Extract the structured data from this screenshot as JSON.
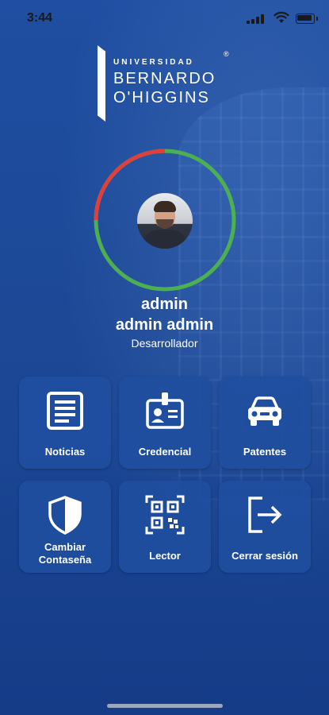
{
  "status_bar": {
    "time": "3:44"
  },
  "logo": {
    "line1": "UNIVERSIDAD",
    "line2": "BERNARDO",
    "line3": "O'HIGGINS",
    "registered": "®"
  },
  "profile": {
    "username": "admin",
    "full_name": "admin admin",
    "role": "Desarrollador",
    "ring_colors": {
      "used": "#e0403a",
      "remaining": "#4caf50"
    }
  },
  "menu": {
    "items": [
      {
        "label": "Noticias",
        "icon": "newspaper-icon"
      },
      {
        "label": "Credencial",
        "icon": "id-badge-icon"
      },
      {
        "label": "Patentes",
        "icon": "car-icon"
      },
      {
        "label": "Cambiar Contaseña",
        "icon": "shield-icon"
      },
      {
        "label": "Lector",
        "icon": "qr-code-icon"
      },
      {
        "label": "Cerrar sesión",
        "icon": "logout-icon"
      }
    ]
  }
}
